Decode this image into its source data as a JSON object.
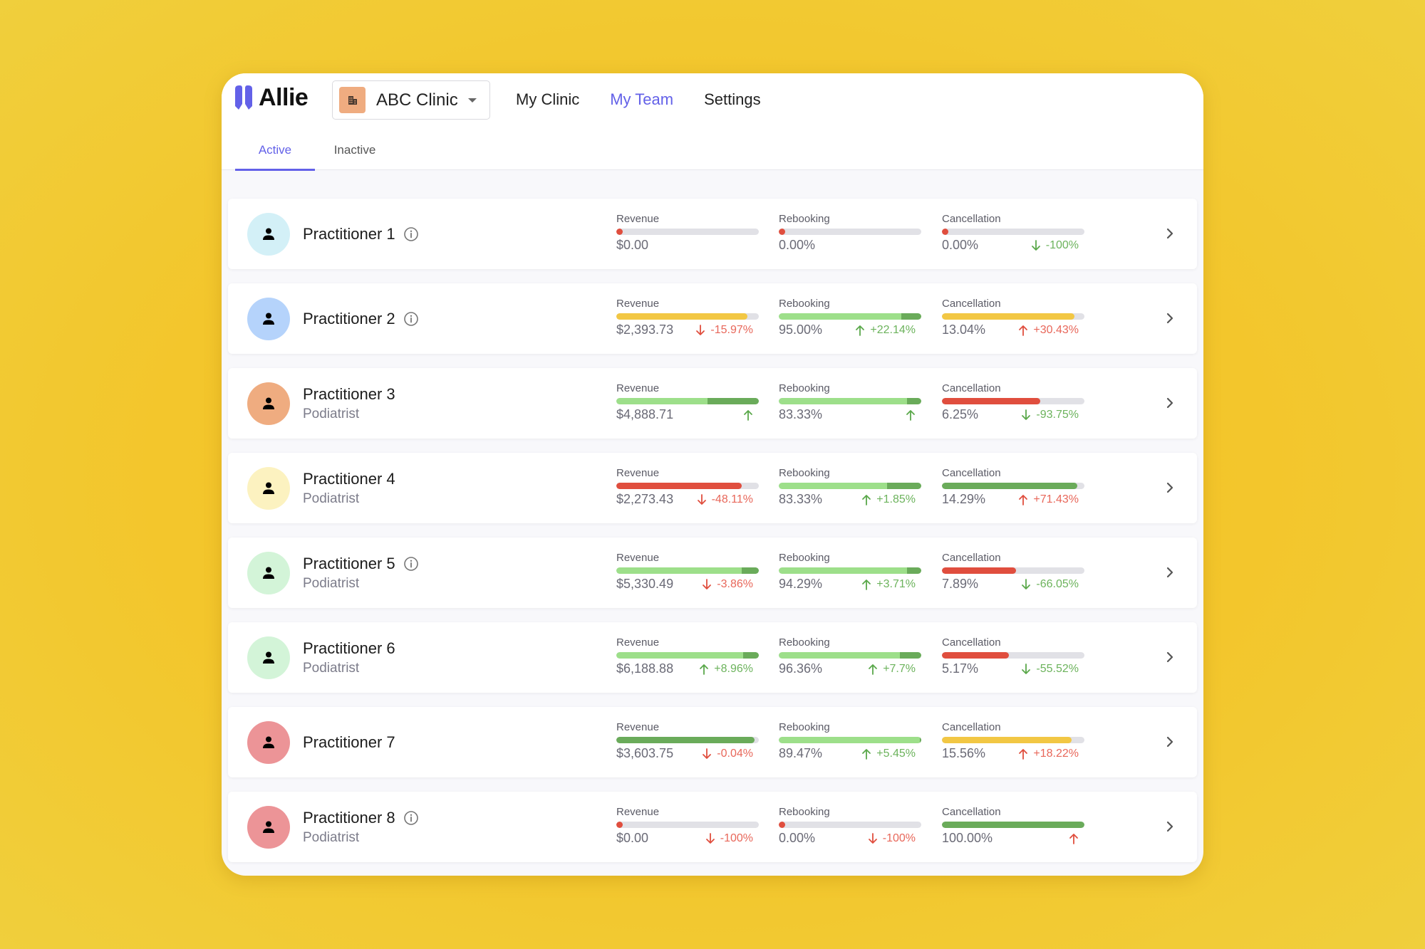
{
  "app": {
    "name": "Allie",
    "brand_color": "#6361e8"
  },
  "clinic_selector": {
    "selected": "ABC Clinic",
    "icon": "building-icon"
  },
  "topnav": [
    {
      "label": "My Clinic",
      "active": false
    },
    {
      "label": "My Team",
      "active": true
    },
    {
      "label": "Settings",
      "active": false
    }
  ],
  "tabs": [
    {
      "label": "Active",
      "active": true
    },
    {
      "label": "Inactive",
      "active": false
    }
  ],
  "colors": {
    "red": "#e04e3e",
    "yellow": "#f2c744",
    "green_light": "#9ddf8a",
    "green_dark": "#6aab5a",
    "track": "#e1e1e6",
    "change_green": "#5aa84a",
    "change_red": "#e04e3e"
  },
  "metric_labels": [
    "Revenue",
    "Rebooking",
    "Cancellation"
  ],
  "practitioners": [
    {
      "name": "Practitioner 1",
      "role": "",
      "info": true,
      "avatar_color": "#d3f0f7",
      "metrics": [
        {
          "value": "$0.00",
          "progress": 0,
          "bar": "zero",
          "change": "",
          "dir": "",
          "tone": ""
        },
        {
          "value": "0.00%",
          "progress": 0,
          "bar": "zero",
          "change": "",
          "dir": "",
          "tone": ""
        },
        {
          "value": "0.00%",
          "progress": 0,
          "bar": "zero",
          "change": "-100%",
          "dir": "down",
          "tone": "good"
        }
      ]
    },
    {
      "name": "Practitioner 2",
      "role": "",
      "info": true,
      "avatar_color": "#b5d3fb",
      "metrics": [
        {
          "value": "$2,393.73",
          "progress": 92,
          "bar": "yellow",
          "change": "-15.97%",
          "dir": "down",
          "tone": "bad"
        },
        {
          "value": "95.00%",
          "progress": 100,
          "bar": "green",
          "split": 86,
          "change": "+22.14%",
          "dir": "up",
          "tone": "good"
        },
        {
          "value": "13.04%",
          "progress": 93,
          "bar": "yellow",
          "change": "+30.43%",
          "dir": "up",
          "tone": "bad"
        }
      ]
    },
    {
      "name": "Practitioner 3",
      "role": "Podiatrist",
      "info": false,
      "avatar_color": "#efac80",
      "metrics": [
        {
          "value": "$4,888.71",
          "progress": 100,
          "bar": "green",
          "split": 64,
          "change": "",
          "dir": "up",
          "tone": "good"
        },
        {
          "value": "83.33%",
          "progress": 100,
          "bar": "green",
          "split": 90,
          "change": "",
          "dir": "up",
          "tone": "good"
        },
        {
          "value": "6.25%",
          "progress": 69,
          "bar": "red",
          "change": "-93.75%",
          "dir": "down",
          "tone": "good"
        }
      ]
    },
    {
      "name": "Practitioner 4",
      "role": "Podiatrist",
      "info": false,
      "avatar_color": "#fcf2c0",
      "metrics": [
        {
          "value": "$2,273.43",
          "progress": 88,
          "bar": "red",
          "change": "-48.11%",
          "dir": "down",
          "tone": "bad"
        },
        {
          "value": "83.33%",
          "progress": 100,
          "bar": "green",
          "split": 76,
          "change": "+1.85%",
          "dir": "up",
          "tone": "good"
        },
        {
          "value": "14.29%",
          "progress": 95,
          "bar": "darkgreen",
          "change": "+71.43%",
          "dir": "up",
          "tone": "bad"
        }
      ]
    },
    {
      "name": "Practitioner 5",
      "role": "Podiatrist",
      "info": true,
      "avatar_color": "#d3f4d8",
      "metrics": [
        {
          "value": "$5,330.49",
          "progress": 100,
          "bar": "green",
          "split": 88,
          "change": "-3.86%",
          "dir": "down",
          "tone": "bad"
        },
        {
          "value": "94.29%",
          "progress": 100,
          "bar": "green",
          "split": 90,
          "change": "+3.71%",
          "dir": "up",
          "tone": "good"
        },
        {
          "value": "7.89%",
          "progress": 52,
          "bar": "red",
          "change": "-66.05%",
          "dir": "down",
          "tone": "good"
        }
      ]
    },
    {
      "name": "Practitioner 6",
      "role": "Podiatrist",
      "info": false,
      "avatar_color": "#d3f4d8",
      "metrics": [
        {
          "value": "$6,188.88",
          "progress": 100,
          "bar": "green",
          "split": 89,
          "change": "+8.96%",
          "dir": "up",
          "tone": "good"
        },
        {
          "value": "96.36%",
          "progress": 100,
          "bar": "green",
          "split": 85,
          "change": "+7.7%",
          "dir": "up",
          "tone": "good"
        },
        {
          "value": "5.17%",
          "progress": 47,
          "bar": "red",
          "change": "-55.52%",
          "dir": "down",
          "tone": "good"
        }
      ]
    },
    {
      "name": "Practitioner 7",
      "role": "",
      "info": false,
      "avatar_color": "#ec9497",
      "metrics": [
        {
          "value": "$3,603.75",
          "progress": 97,
          "bar": "darkgreen",
          "change": "-0.04%",
          "dir": "down",
          "tone": "bad"
        },
        {
          "value": "89.47%",
          "progress": 100,
          "bar": "green",
          "split": 99,
          "change": "+5.45%",
          "dir": "up",
          "tone": "good"
        },
        {
          "value": "15.56%",
          "progress": 91,
          "bar": "yellow",
          "change": "+18.22%",
          "dir": "up",
          "tone": "bad"
        }
      ]
    },
    {
      "name": "Practitioner 8",
      "role": "Podiatrist",
      "info": true,
      "avatar_color": "#ec9497",
      "metrics": [
        {
          "value": "$0.00",
          "progress": 0,
          "bar": "zero",
          "change": "-100%",
          "dir": "down",
          "tone": "bad"
        },
        {
          "value": "0.00%",
          "progress": 0,
          "bar": "zero",
          "change": "-100%",
          "dir": "down",
          "tone": "bad"
        },
        {
          "value": "100.00%",
          "progress": 100,
          "bar": "darkgreen",
          "change": "",
          "dir": "up",
          "tone": "bad"
        }
      ]
    }
  ]
}
